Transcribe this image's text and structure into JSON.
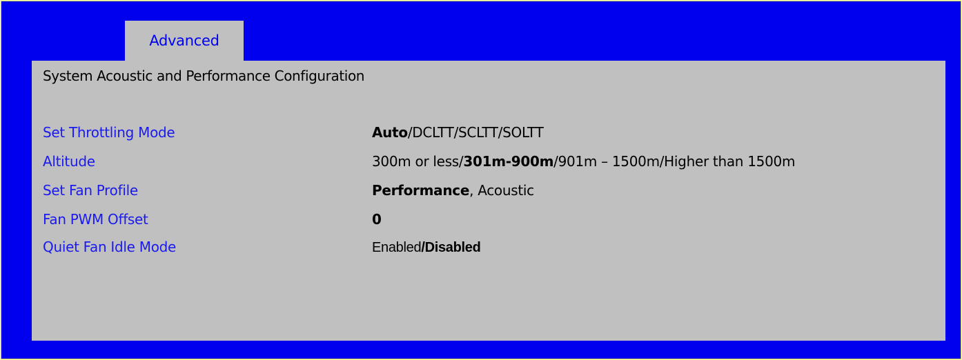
{
  "tab": {
    "label": "Advanced"
  },
  "page": {
    "title": "System Acoustic and Performance Configuration"
  },
  "settings": [
    {
      "label": "Set Throttling Mode",
      "parts": [
        {
          "text": "Auto",
          "bold": true
        },
        {
          "text": "/DCLTT/SCLTT/SOLTT",
          "bold": false
        }
      ]
    },
    {
      "label": "Altitude",
      "parts": [
        {
          "text": "300m or less/",
          "bold": false
        },
        {
          "text": "301m-900m",
          "bold": true
        },
        {
          "text": "/901m – 1500m/Higher than 1500m",
          "bold": false
        }
      ]
    },
    {
      "label": "Set Fan Profile",
      "parts": [
        {
          "text": "Performance",
          "bold": true
        },
        {
          "text": ", Acoustic",
          "bold": false
        }
      ]
    },
    {
      "label": "Fan PWM Offset",
      "parts": [
        {
          "text": "0",
          "bold": true
        }
      ]
    },
    {
      "label": "Quiet Fan Idle Mode",
      "parts": [
        {
          "text": "Enabled",
          "bold": false
        },
        {
          "text": "/Disabled",
          "bold": true
        }
      ]
    }
  ],
  "colors": {
    "background": "#0000ee",
    "panel": "#c0c0c0",
    "label": "#1a1aee",
    "value": "#000000"
  }
}
